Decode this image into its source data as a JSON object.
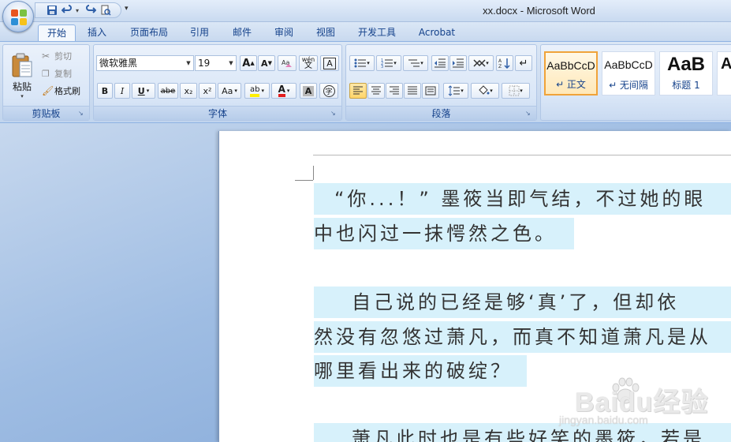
{
  "window": {
    "title": "xx.docx - Microsoft Word"
  },
  "tabs": [
    "开始",
    "插入",
    "页面布局",
    "引用",
    "邮件",
    "审阅",
    "视图",
    "开发工具",
    "Acrobat"
  ],
  "clipboard": {
    "paste": "粘贴",
    "cut": "剪切",
    "copy": "复制",
    "format_painter": "格式刷",
    "label": "剪贴板"
  },
  "font": {
    "name": "微软雅黑",
    "size": "19",
    "grow": "A",
    "shrink": "A",
    "pinyin": "wén",
    "bold": "B",
    "italic": "I",
    "underline": "U",
    "strike": "abe",
    "subscript": "x₂",
    "superscript": "x²",
    "case": "Aa",
    "highlight": "ab",
    "color": "A",
    "shade": "A",
    "enclose": "字",
    "label": "字体"
  },
  "paragraph": {
    "label": "段落"
  },
  "styles": [
    {
      "sample": "AaBbCcD",
      "name": "↵ 正文"
    },
    {
      "sample": "AaBbCcD",
      "name": "↵ 无间隔"
    },
    {
      "sample": "AaB",
      "name": "标题 1"
    },
    {
      "sample": "A",
      "name": ""
    }
  ],
  "document": {
    "lines": [
      "“你...！” 墨筱当即气结，不过她的眼",
      "中也闪过一抹愕然之色。",
      "自己说的已经是够‘真’了，但却依",
      "然没有忽悠过萧凡，而真不知道萧凡是从",
      "哪里看出来的破绽？",
      "萧凡此时也是有些好笑的墨筱，若是"
    ]
  },
  "watermark": {
    "brand": "Baidu经验",
    "url": "jingyan.baidu.com"
  },
  "colors": {
    "highlight": "#d7f1fb",
    "accent": "#f0a33a",
    "ribbon_text": "#15428b"
  }
}
